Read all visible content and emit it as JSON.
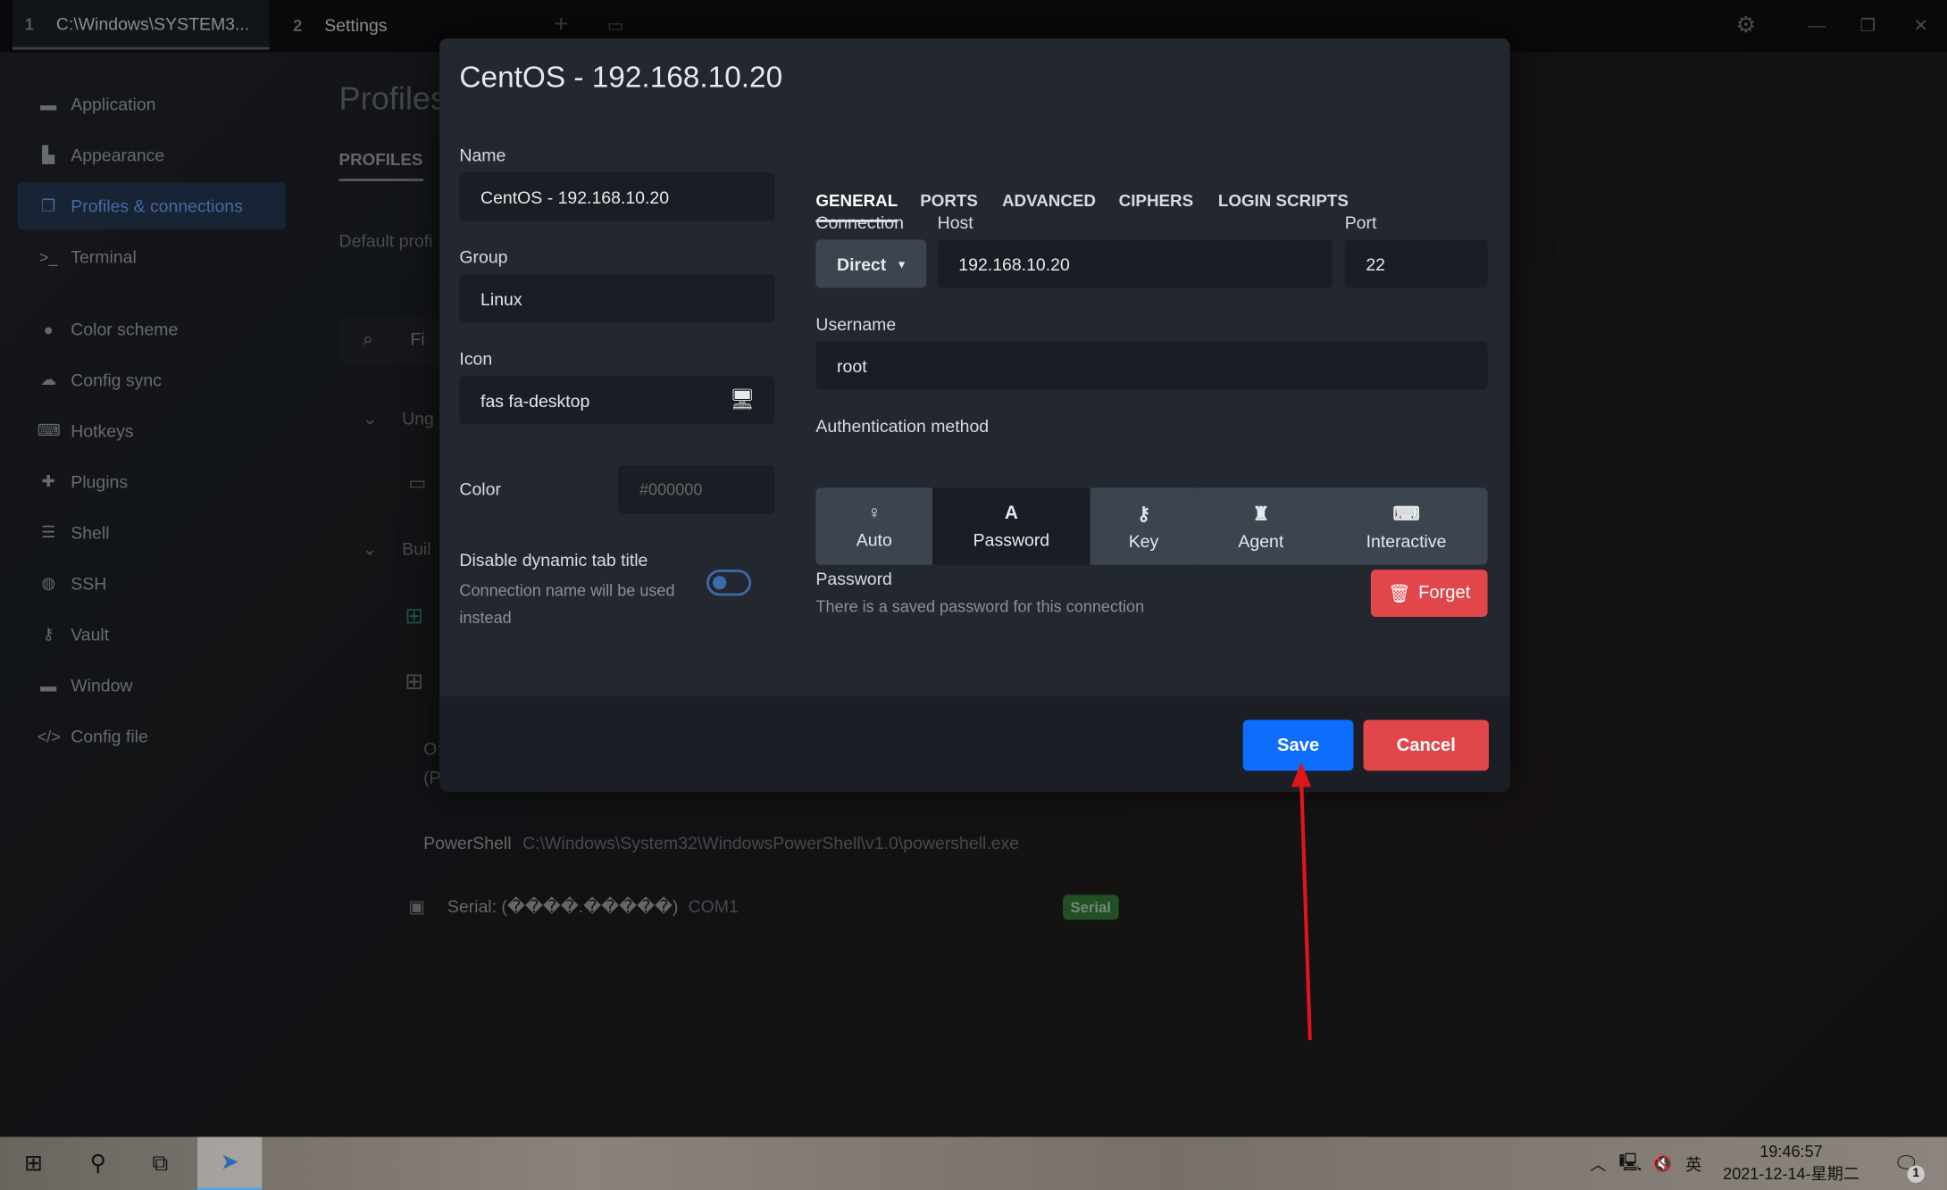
{
  "tabs": [
    {
      "num": "1",
      "label": "C:\\Windows\\SYSTEM3..."
    },
    {
      "num": "2",
      "label": "Settings"
    }
  ],
  "sidebar": {
    "items": [
      {
        "label": "Application",
        "icon": "window-icon"
      },
      {
        "label": "Appearance",
        "icon": "paint-icon"
      },
      {
        "label": "Profiles & connections",
        "icon": "profiles-icon",
        "active": true
      },
      {
        "label": "Terminal",
        "icon": "terminal-icon"
      },
      {
        "label": "Color scheme",
        "icon": "palette-icon"
      },
      {
        "label": "Config sync",
        "icon": "cloud-icon"
      },
      {
        "label": "Hotkeys",
        "icon": "keyboard-icon"
      },
      {
        "label": "Plugins",
        "icon": "puzzle-icon"
      },
      {
        "label": "Shell",
        "icon": "list-icon"
      },
      {
        "label": "SSH",
        "icon": "globe-icon"
      },
      {
        "label": "Vault",
        "icon": "key-icon"
      },
      {
        "label": "Window",
        "icon": "window-icon"
      },
      {
        "label": "Config file",
        "icon": "code-icon"
      }
    ]
  },
  "background": {
    "title": "Profiles",
    "tab": "PROFILES",
    "default_profile": "Default profi",
    "search_placeholder": "Fi",
    "group1": "Ung",
    "group2": "Buil",
    "os_label": "O:",
    "os_sub": "(P",
    "powershell_name": "PowerShell",
    "powershell_path": "C:\\Windows\\System32\\WindowsPowerShell\\v1.0\\powershell.exe",
    "serial_name": "Serial: (����.�����)",
    "serial_port": "COM1",
    "serial_badge": "Serial"
  },
  "dialog": {
    "title": "CentOS - 192.168.10.20",
    "name_label": "Name",
    "name_value": "CentOS  - 192.168.10.20",
    "group_label": "Group",
    "group_value": "Linux",
    "icon_label": "Icon",
    "icon_value": "fas fa-desktop",
    "color_label": "Color",
    "color_placeholder": "#000000",
    "dynamic_title_label": "Disable dynamic tab title",
    "dynamic_title_desc": "Connection name will be used instead",
    "dynamic_title_on": false,
    "tabs": [
      "GENERAL",
      "PORTS",
      "ADVANCED",
      "CIPHERS",
      "LOGIN SCRIPTS"
    ],
    "active_tab": "GENERAL",
    "connection_label": "Connection",
    "connection_value": "Direct",
    "host_label": "Host",
    "host_value": "192.168.10.20",
    "port_label": "Port",
    "port_value": "22",
    "username_label": "Username",
    "username_value": "root",
    "auth_label": "Authentication method",
    "auth_methods": [
      {
        "label": "Auto",
        "icon": "lightbulb-icon",
        "glyph": "💡"
      },
      {
        "label": "Password",
        "icon": "font-icon",
        "glyph": "A"
      },
      {
        "label": "Key",
        "icon": "key-icon",
        "glyph": "🔑"
      },
      {
        "label": "Agent",
        "icon": "user-secret-icon",
        "glyph": "♜"
      },
      {
        "label": "Interactive",
        "icon": "keyboard-icon",
        "glyph": "⌨"
      }
    ],
    "auth_selected": "Password",
    "password_label": "Password",
    "password_desc": "There is a saved password for this connection",
    "forget_label": "Forget",
    "save_label": "Save",
    "cancel_label": "Cancel"
  },
  "colors": {
    "accent": "#0d6efd",
    "danger": "#e0464a",
    "serial_badge": "#2f6a35"
  },
  "taskbar": {
    "time": "19:46:57",
    "date": "2021-12-14-星期二",
    "ime": "英",
    "notifications": "1"
  }
}
